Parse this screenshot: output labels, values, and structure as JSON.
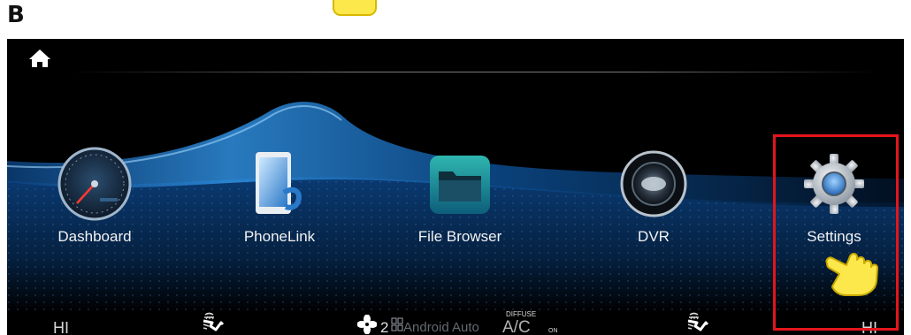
{
  "panel_letter": "B",
  "apps": [
    {
      "label": "Dashboard",
      "icon": "speedometer-icon"
    },
    {
      "label": "PhoneLink",
      "icon": "phonelink-icon"
    },
    {
      "label": "File Browser",
      "icon": "folder-icon"
    },
    {
      "label": "DVR",
      "icon": "camera-lens-icon"
    },
    {
      "label": "Settings",
      "icon": "gear-icon"
    }
  ],
  "climate": {
    "left_temp": "HI",
    "right_temp": "HI",
    "fan_level": "2",
    "android_auto": "Android Auto",
    "ac_label": "A/C",
    "ac_mode": "DIFFUSE",
    "ac_state": "ON"
  },
  "colors": {
    "highlight": "#e3151b",
    "pointer_hand": "#fde84b",
    "screen_background": "#000000",
    "wave_blue": "#2f8fe0"
  }
}
